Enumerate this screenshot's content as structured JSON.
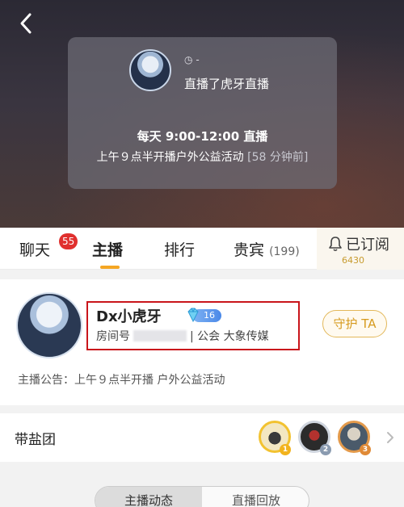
{
  "overlay": {
    "clock_text": "-",
    "live_text": "直播了虎牙直播",
    "schedule": "每天 9:00-12:00 直播",
    "event": "上午９点半开播户外公益活动",
    "ago": "[58 分钟前]"
  },
  "tabs": {
    "chat": "聊天",
    "chat_badge": "55",
    "host": "主播",
    "rank": "排行",
    "vip": "贵宾",
    "vip_count": "(199)",
    "subscribe": "已订阅",
    "subscribe_count": "6430"
  },
  "profile": {
    "name": "Dx小虎牙",
    "level": "16",
    "room_label": "房间号",
    "guild": "| 公会  大象传媒",
    "guard_button": "守护 TA",
    "notice": "主播公告：上午９点半开播 户外公益活动"
  },
  "salt_group": {
    "label": "带盐团",
    "fans": [
      {
        "rank": "1"
      },
      {
        "rank": "2"
      },
      {
        "rank": "3"
      }
    ]
  },
  "bottom_tabs": {
    "dynamics": "主播动态",
    "replay": "直播回放"
  },
  "colors": {
    "accent": "#f5a623",
    "badge": "#e0302e",
    "highlight_box": "#c9151b",
    "level_badge": "#4a88e8"
  }
}
